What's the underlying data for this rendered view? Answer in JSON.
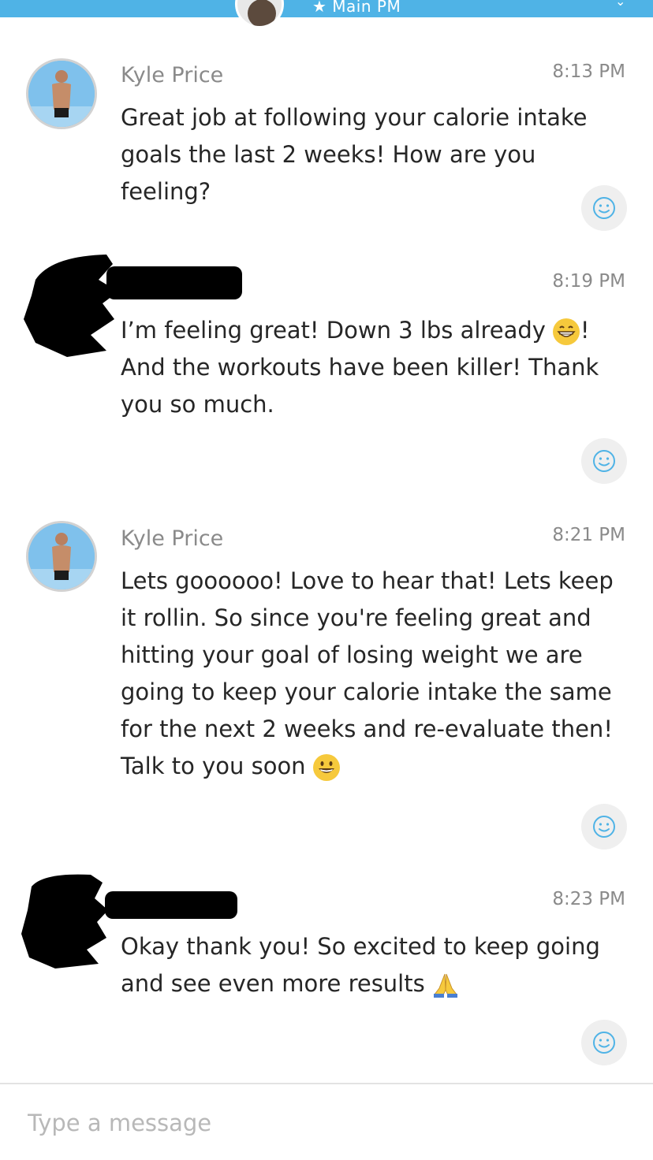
{
  "header": {
    "title": "★ Main PM"
  },
  "messages": [
    {
      "sender": "Kyle Price",
      "time": "8:13 PM",
      "text": "Great job at following your calorie intake goals the last 2 weeks! How are you feeling?",
      "emoji": ""
    },
    {
      "sender": "",
      "time": "8:19 PM",
      "text": "I’m feeling great! Down 3 lbs already",
      "emoji": "grin",
      "text_after": "! And the workouts have been killer! Thank you so much."
    },
    {
      "sender": "Kyle Price",
      "time": "8:21 PM",
      "text": "Lets goooooo! Love to hear that! Lets keep it rollin. So since you're feeling great and hitting your goal of losing weight we are going to keep your calorie intake the same for the next 2 weeks and re-evaluate then! Talk to you soon",
      "emoji": "smile"
    },
    {
      "sender": "",
      "time": "8:23 PM",
      "text": "Okay thank you! So excited to keep going and see even more results",
      "emoji": "pray"
    }
  ],
  "composer": {
    "placeholder": "Type a message"
  },
  "colors": {
    "accent": "#4fb3e6",
    "muted_text": "#8a8a8a",
    "reaction_bg": "#efefef"
  }
}
